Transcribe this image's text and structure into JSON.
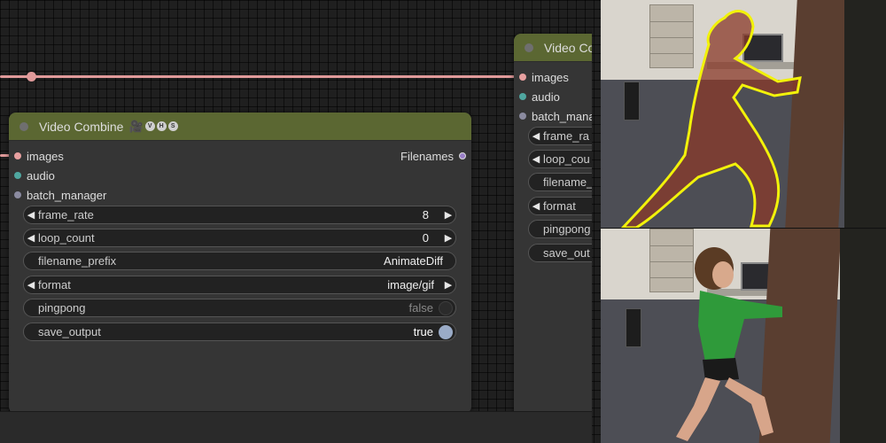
{
  "node_left": {
    "title": "Video Combine",
    "badge_icon": "camera-icon",
    "badges": [
      "V",
      "H",
      "S"
    ],
    "inputs": [
      {
        "name": "images",
        "color": "#e8a0a0"
      },
      {
        "name": "audio",
        "color": "#4fa7a0"
      },
      {
        "name": "batch_manager",
        "color": "#8b8ba0"
      }
    ],
    "output": {
      "name": "Filenames",
      "color": "#9a7fc7"
    },
    "widgets": {
      "frame_rate": {
        "label": "frame_rate",
        "value": "8"
      },
      "loop_count": {
        "label": "loop_count",
        "value": "0"
      },
      "filename_prefix": {
        "label": "filename_prefix",
        "value": "AnimateDiff"
      },
      "format": {
        "label": "format",
        "value": "image/gif"
      },
      "pingpong": {
        "label": "pingpong",
        "value": "false"
      },
      "save_output": {
        "label": "save_output",
        "value": "true"
      }
    }
  },
  "node_right": {
    "title": "Video Co",
    "inputs": [
      {
        "name": "images"
      },
      {
        "name": "audio"
      },
      {
        "name": "batch_mana"
      }
    ],
    "widgets": {
      "frame_rate": "frame_ra",
      "loop_count": "loop_cou",
      "filename_prefix": "filename_",
      "format": "format",
      "pingpong": "pingpong",
      "save_output": "save_out"
    }
  },
  "colors": {
    "header": "#5b6732",
    "node_body": "#353535",
    "link": "#e09a9a",
    "toggle_on": "#9aabc7"
  }
}
